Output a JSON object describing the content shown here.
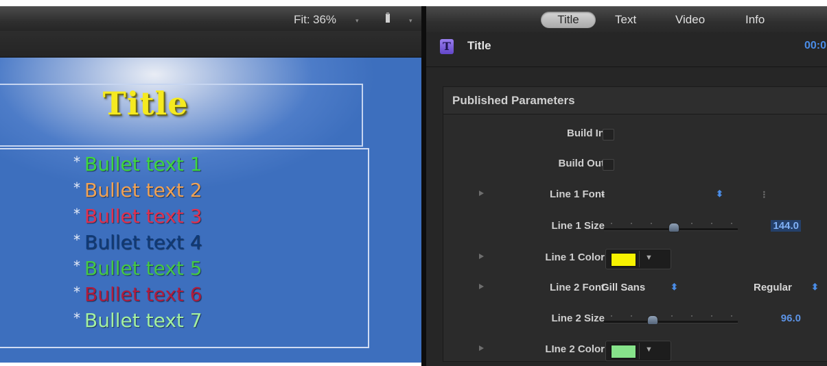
{
  "viewer": {
    "fit_label": "Fit:",
    "zoom_value": "36%",
    "zoom_chevron": "▾",
    "view_chevron": "▾",
    "canvas": {
      "title": "Title",
      "bullets": [
        {
          "text": "Bullet text 1",
          "color": "#3fd63f"
        },
        {
          "text": "Bullet text 2",
          "color": "#f0a255"
        },
        {
          "text": "Bullet text 3",
          "color": "#e0304e"
        },
        {
          "text": "Bullet text 4",
          "color": "#0f3a78"
        },
        {
          "text": "Bullet text 5",
          "color": "#45c845"
        },
        {
          "text": "Bullet text 6",
          "color": "#b01c3e"
        },
        {
          "text": "Bullet text 7",
          "color": "#a4f0a0"
        }
      ],
      "bullet_symbol": "*",
      "title_color": "#f5ea20"
    }
  },
  "inspector": {
    "tabs": [
      {
        "label": "Title",
        "active": true
      },
      {
        "label": "Text",
        "active": false
      },
      {
        "label": "Video",
        "active": false
      },
      {
        "label": "Info",
        "active": false
      }
    ],
    "header": {
      "icon": "title-generator-icon",
      "icon_glyph": "T",
      "title": "Title",
      "timecode": "00:0"
    },
    "section_title": "Published Parameters",
    "params": {
      "build_in": {
        "label": "Build In",
        "checked": false
      },
      "build_out": {
        "label": "Build Out",
        "checked": false
      },
      "line1_font": {
        "label": "Line 1 Font",
        "value": "-",
        "stepper": "⬍",
        "extra": "⁝"
      },
      "line1_size": {
        "label": "Line 1 Size",
        "value": "144.0",
        "slider_fraction": 0.52
      },
      "line1_color": {
        "label": "Line 1 Color",
        "color": "#f7f200",
        "chevron": "▼"
      },
      "line2_font": {
        "label": "Line 2 Font",
        "value": "Gill Sans",
        "stepper": "⬍",
        "style": "Regular",
        "style_stepper": "⬍"
      },
      "line2_size": {
        "label": "Line 2 Size",
        "value": "96.0",
        "slider_fraction": 0.36
      },
      "line2_color": {
        "label": "LIne 2 Color",
        "color": "#86e38a",
        "chevron": "▼"
      }
    },
    "accent_color": "#4a8ce6"
  }
}
